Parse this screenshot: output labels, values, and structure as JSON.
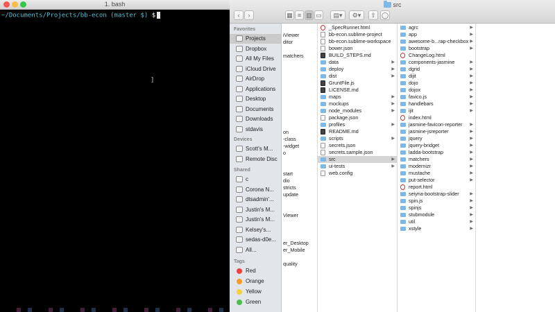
{
  "terminal": {
    "title": "1. bash",
    "prompt_path": "~/Documents/Projects/bb-econ",
    "prompt_branch": "(master $)",
    "prompt_symbol": "$",
    "stray_char": "]"
  },
  "finder": {
    "title": "src",
    "nav": {
      "back": "‹",
      "forward": "›"
    },
    "sidebar": {
      "favorites_header": "Favorites",
      "favorites": [
        "Projects",
        "Dropbox",
        "All My Files",
        "iCloud Drive",
        "AirDrop",
        "Applications",
        "Desktop",
        "Documents",
        "Downloads",
        "stdavis"
      ],
      "devices_header": "Devices",
      "devices": [
        "Scott's M...",
        "Remote Disc"
      ],
      "shared_header": "Shared",
      "shared": [
        "c",
        "Corona N...",
        "dtsadmin'...",
        "Justin's M...",
        "Justin's M...",
        "Kelsey's...",
        "sedas-d0e...",
        "All..."
      ],
      "tags_header": "Tags",
      "tags": [
        {
          "label": "Red",
          "color": "#f0413f"
        },
        {
          "label": "Orange",
          "color": "#f59b26"
        },
        {
          "label": "Yellow",
          "color": "#f4d33a"
        },
        {
          "label": "Green",
          "color": "#4bbf4b"
        }
      ]
    },
    "col1": [
      "iViewer",
      "ditor",
      "",
      "matchers",
      "",
      "",
      "",
      "",
      "",
      "",
      "",
      "",
      "",
      "",
      "on",
      "-class",
      "-widget",
      "o",
      "",
      "",
      "start",
      "dio",
      "stricts",
      "update",
      "",
      "",
      "Viewer",
      "",
      "",
      "",
      "er_Desktop",
      "er_Mobile",
      "",
      "quality"
    ],
    "col2": [
      {
        "label": "_SpecRunner.html",
        "icon": "html"
      },
      {
        "label": "bb-econ.sublime-project",
        "icon": "file"
      },
      {
        "label": "bb-econ.sublime-workspace",
        "icon": "file"
      },
      {
        "label": "bower.json",
        "icon": "file"
      },
      {
        "label": "BUILD_STEPS.md",
        "icon": "dark"
      },
      {
        "label": "data",
        "icon": "folder",
        "chev": true
      },
      {
        "label": "deploy",
        "icon": "folder",
        "chev": true
      },
      {
        "label": "dist",
        "icon": "folder",
        "chev": true
      },
      {
        "label": "GruntFile.js",
        "icon": "dark"
      },
      {
        "label": "LICENSE.md",
        "icon": "dark"
      },
      {
        "label": "maps",
        "icon": "folder",
        "chev": true
      },
      {
        "label": "mockups",
        "icon": "folder",
        "chev": true
      },
      {
        "label": "node_modules",
        "icon": "folder",
        "chev": true
      },
      {
        "label": "package.json",
        "icon": "file"
      },
      {
        "label": "profiles",
        "icon": "folder",
        "chev": true
      },
      {
        "label": "README.md",
        "icon": "dark"
      },
      {
        "label": "scripts",
        "icon": "folder",
        "chev": true
      },
      {
        "label": "secrets.json",
        "icon": "file"
      },
      {
        "label": "secrets.sample.json",
        "icon": "file"
      },
      {
        "label": "src",
        "icon": "folder",
        "chev": true,
        "selected": true
      },
      {
        "label": "ui-tests",
        "icon": "folder",
        "chev": true
      },
      {
        "label": "web.config",
        "icon": "file"
      }
    ],
    "col3": [
      {
        "label": "agrc",
        "icon": "folder",
        "chev": true
      },
      {
        "label": "app",
        "icon": "folder",
        "chev": true
      },
      {
        "label": "awesome-b...rap-checkbox",
        "icon": "folder",
        "chev": true
      },
      {
        "label": "bootstrap",
        "icon": "folder",
        "chev": true
      },
      {
        "label": "ChangeLog.html",
        "icon": "html"
      },
      {
        "label": "components-jasmine",
        "icon": "folder",
        "chev": true
      },
      {
        "label": "dgrid",
        "icon": "folder",
        "chev": true
      },
      {
        "label": "dijit",
        "icon": "folder",
        "chev": true
      },
      {
        "label": "dojo",
        "icon": "folder",
        "chev": true
      },
      {
        "label": "dojox",
        "icon": "folder",
        "chev": true
      },
      {
        "label": "favico.js",
        "icon": "folder",
        "chev": true
      },
      {
        "label": "handlebars",
        "icon": "folder",
        "chev": true
      },
      {
        "label": "ijit",
        "icon": "folder",
        "chev": true
      },
      {
        "label": "index.html",
        "icon": "html"
      },
      {
        "label": "jasmine-favicon-reporter",
        "icon": "folder",
        "chev": true
      },
      {
        "label": "jasmine-jsreporter",
        "icon": "folder",
        "chev": true
      },
      {
        "label": "jquery",
        "icon": "folder",
        "chev": true
      },
      {
        "label": "jquery-bridget",
        "icon": "folder",
        "chev": true
      },
      {
        "label": "ladda-bootstrap",
        "icon": "folder",
        "chev": true
      },
      {
        "label": "matchers",
        "icon": "folder",
        "chev": true
      },
      {
        "label": "modernizr",
        "icon": "folder",
        "chev": true
      },
      {
        "label": "mustache",
        "icon": "folder",
        "chev": true
      },
      {
        "label": "put-selector",
        "icon": "folder",
        "chev": true
      },
      {
        "label": "report.html",
        "icon": "html"
      },
      {
        "label": "seiyria-bootstrap-slider",
        "icon": "folder",
        "chev": true
      },
      {
        "label": "spin.js",
        "icon": "folder",
        "chev": true
      },
      {
        "label": "spinjs",
        "icon": "folder",
        "chev": true
      },
      {
        "label": "stubmodule",
        "icon": "folder",
        "chev": true
      },
      {
        "label": "util",
        "icon": "folder",
        "chev": true
      },
      {
        "label": "xstyle",
        "icon": "folder",
        "chev": true
      }
    ]
  }
}
